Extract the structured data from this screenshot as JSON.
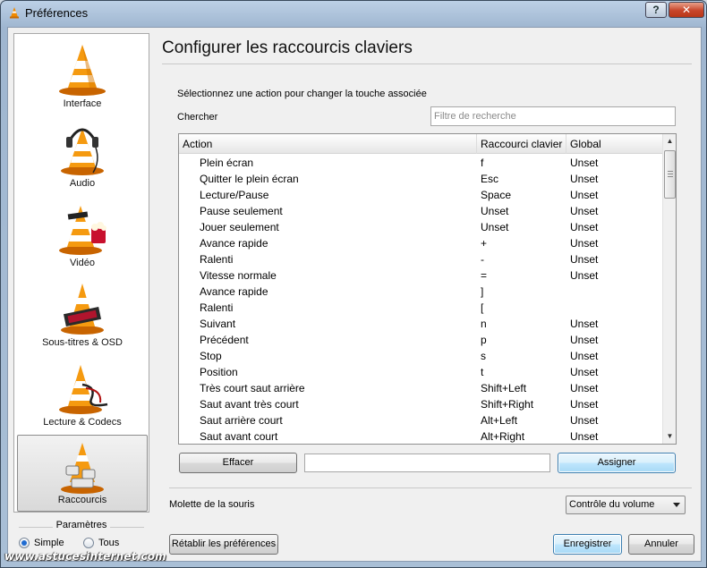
{
  "window": {
    "title": "Préférences",
    "help_label": "?",
    "close_label": "✕"
  },
  "sidebar": {
    "items": [
      {
        "label": "Interface",
        "icon": "vlc-cone-icon"
      },
      {
        "label": "Audio",
        "icon": "vlc-cone-headphones-icon"
      },
      {
        "label": "Vidéo",
        "icon": "vlc-cone-film-icon"
      },
      {
        "label": "Sous-titres & OSD",
        "icon": "vlc-cone-subtitles-icon"
      },
      {
        "label": "Lecture & Codecs",
        "icon": "vlc-cone-cables-icon"
      },
      {
        "label": "Raccourcis",
        "icon": "vlc-cone-keyboard-icon",
        "selected": true
      }
    ]
  },
  "params": {
    "title": "Paramètres",
    "simple_label": "Simple",
    "all_label": "Tous",
    "selected": "Simple"
  },
  "main": {
    "title": "Configurer les raccourcis claviers",
    "instruction": "Sélectionnez une action pour changer la touche associée",
    "search_label": "Chercher",
    "search_placeholder": "Filtre de recherche",
    "search_value": ""
  },
  "table": {
    "columns": [
      "Action",
      "Raccourci clavier",
      "Global"
    ],
    "rows": [
      {
        "action": "Plein écran",
        "key": "f",
        "global": "Unset"
      },
      {
        "action": "Quitter le plein écran",
        "key": "Esc",
        "global": "Unset"
      },
      {
        "action": "Lecture/Pause",
        "key": "Space",
        "global": "Unset"
      },
      {
        "action": "Pause seulement",
        "key": "Unset",
        "global": "Unset"
      },
      {
        "action": "Jouer seulement",
        "key": "Unset",
        "global": "Unset"
      },
      {
        "action": "Avance rapide",
        "key": "+",
        "global": "Unset"
      },
      {
        "action": "Ralenti",
        "key": "-",
        "global": "Unset"
      },
      {
        "action": "Vitesse normale",
        "key": "=",
        "global": "Unset"
      },
      {
        "action": "Avance rapide",
        "key": "]",
        "global": ""
      },
      {
        "action": "Ralenti",
        "key": "[",
        "global": ""
      },
      {
        "action": "Suivant",
        "key": "n",
        "global": "Unset"
      },
      {
        "action": "Précédent",
        "key": "p",
        "global": "Unset"
      },
      {
        "action": "Stop",
        "key": "s",
        "global": "Unset"
      },
      {
        "action": "Position",
        "key": "t",
        "global": "Unset"
      },
      {
        "action": "Très court saut arrière",
        "key": "Shift+Left",
        "global": "Unset"
      },
      {
        "action": "Saut avant très court",
        "key": "Shift+Right",
        "global": "Unset"
      },
      {
        "action": "Saut arrière court",
        "key": "Alt+Left",
        "global": "Unset"
      },
      {
        "action": "Saut avant court",
        "key": "Alt+Right",
        "global": "Unset"
      }
    ]
  },
  "actions": {
    "clear_label": "Effacer",
    "assign_label": "Assigner",
    "key_value": ""
  },
  "wheel": {
    "label": "Molette de la souris",
    "selected": "Contrôle du volume"
  },
  "footer": {
    "reset_label": "Rétablir les préférences",
    "save_label": "Enregistrer",
    "cancel_label": "Annuler"
  },
  "watermark": "www.astucesinternet.com",
  "colors": {
    "accent": "#3c7fb1",
    "close": "#c8452a",
    "cone_orange": "#f08a00"
  }
}
